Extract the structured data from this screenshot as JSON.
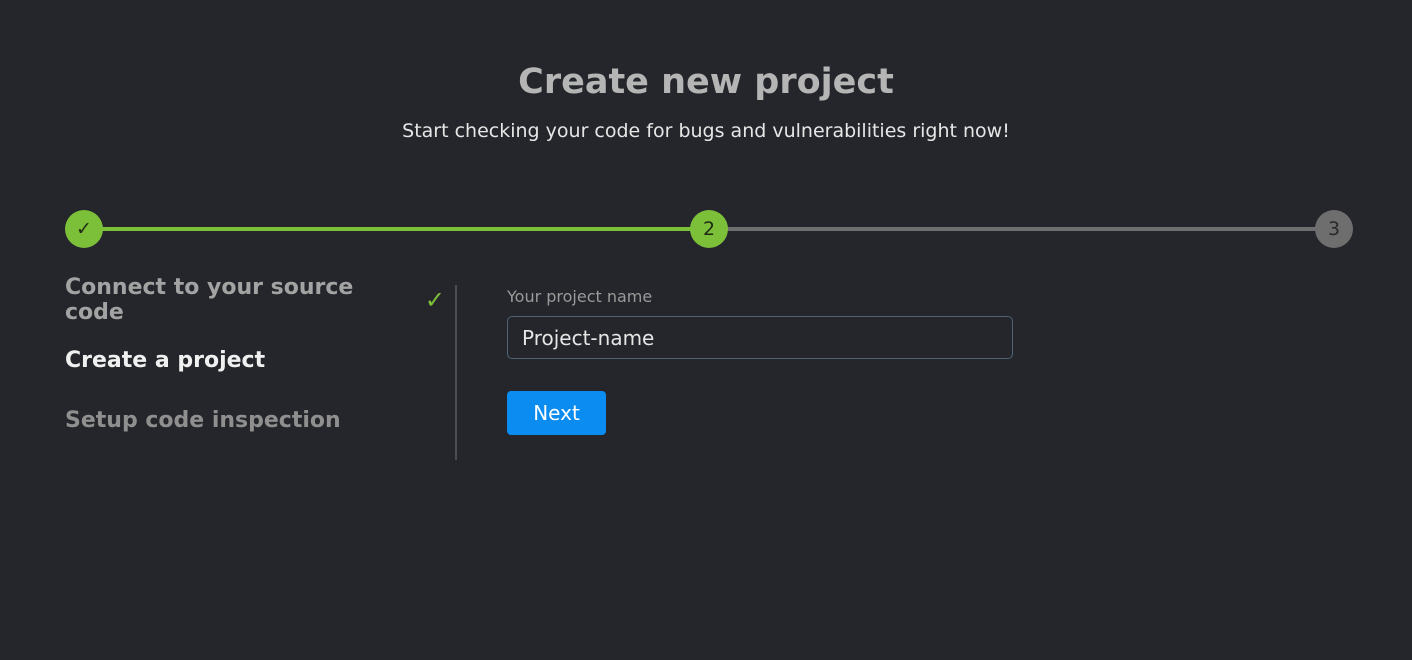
{
  "header": {
    "title": "Create new project",
    "subtitle": "Start checking your code for bugs and vulnerabilities right now!"
  },
  "stepper": {
    "current_step": 2,
    "total_steps": 3,
    "steps": [
      {
        "marker": "✓",
        "state": "completed"
      },
      {
        "marker": "2",
        "state": "active"
      },
      {
        "marker": "3",
        "state": "pending"
      }
    ]
  },
  "steps_nav": {
    "items": [
      {
        "label": "Connect to your source code",
        "state": "completed",
        "icon": "check-icon"
      },
      {
        "label": "Create a project",
        "state": "active"
      },
      {
        "label": "Setup code inspection",
        "state": "pending"
      }
    ],
    "check_glyph": "✓"
  },
  "form": {
    "name_label": "Your project name",
    "name_value": "Project-name",
    "next_label": "Next"
  },
  "colors": {
    "background": "#24262b",
    "accent_green": "#7cc03a",
    "inactive_gray": "#6e6e6e",
    "button_blue": "#0b8cf0"
  }
}
